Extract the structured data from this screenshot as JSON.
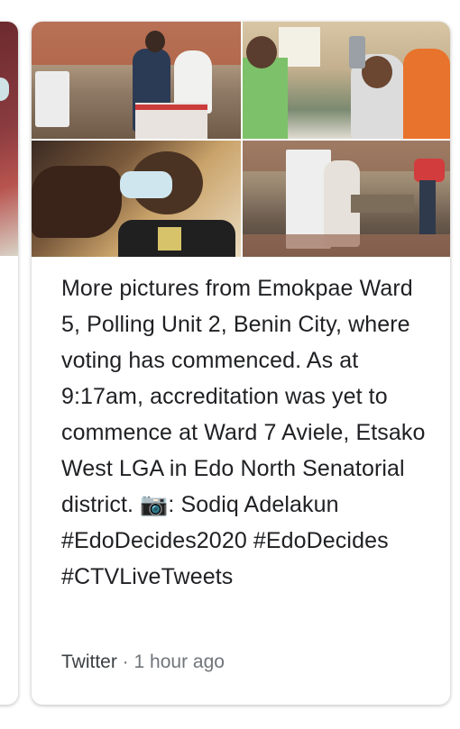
{
  "post": {
    "text": "More pictures from Emokpae Ward 5, Polling Unit 2, Benin City, where voting has commenced. As at 9:17am, accreditation was yet to commence at Ward 7 Aviele, Etsako West LGA in Edo North Senatorial district. 📷: Sodiq Adelakun #EdoDecides2020 #EdoDecides #CTVLiveTweets",
    "source": "Twitter",
    "separator": " · ",
    "time": "1 hour ago"
  },
  "images": [
    "photo-1",
    "photo-2",
    "photo-3",
    "photo-4"
  ]
}
